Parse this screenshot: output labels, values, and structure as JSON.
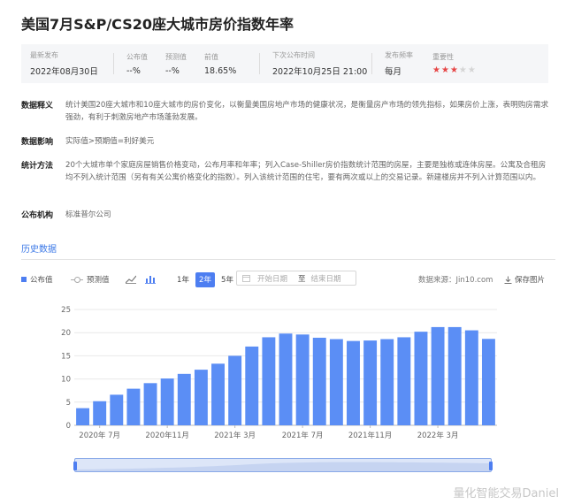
{
  "title": "美国7月S&P/CS20座大城市房价指数年率",
  "info": {
    "latest_label": "最新发布",
    "latest_value": "2022年08月30日",
    "actual_label": "公布值",
    "actual_value": "--%",
    "forecast_label": "预测值",
    "forecast_value": "--%",
    "previous_label": "前值",
    "previous_value": "18.65%",
    "next_label": "下次公布时间",
    "next_value": "2022年10月25日 21:00",
    "freq_label": "发布频率",
    "freq_value": "每月",
    "importance_label": "重要性",
    "importance_stars": 3,
    "importance_max": 5
  },
  "details": [
    {
      "label": "数据释义",
      "text": "统计美国20座大城市和10座大城市的房价变化，以衡量美国房地产市场的健康状况，是衡量房产市场的领先指标，如果房价上涨，表明购房需求强劲，有利于刺激房地产市场蓬勃发展。"
    },
    {
      "label": "数据影响",
      "text": "实际值>预期值=利好美元"
    },
    {
      "label": "统计方法",
      "text": "20个大城市单个家庭房屋销售价格变动，公布月率和年率；列入Case-Shiller房价指数统计范围的房屋，主要是独栋或连体房屋。公寓及合租房均不列入统计范围（另有有关公寓价格变化的指数）。列入该统计范围的住宅，要有两次或以上的交易记录。新建楼房并不列入计算范围以内。"
    },
    {
      "label": "公布机构",
      "text": "标准普尔公司"
    }
  ],
  "history_label": "历史数据",
  "controls": {
    "legend_actual": "公布值",
    "legend_forecast": "预测值",
    "periods": [
      "1年",
      "2年",
      "5年"
    ],
    "active_period": "2年",
    "start_placeholder": "开始日期",
    "to_label": "至",
    "end_placeholder": "结束日期",
    "source": "数据来源：Jin10.com",
    "save_label": "保存图片"
  },
  "colors": {
    "bar": "#5b8ef5",
    "accent": "#4d7ef1",
    "star_on": "#e64545"
  },
  "icons": [
    "line-chart-icon",
    "bar-chart-icon",
    "calendar-icon",
    "download-icon"
  ],
  "chart_data": {
    "type": "bar",
    "categories": [
      "2020年6月",
      "2020年7月",
      "2020年8月",
      "2020年9月",
      "2020年10月",
      "2020年11月",
      "2020年12月",
      "2021年1月",
      "2021年2月",
      "2021年3月",
      "2021年4月",
      "2021年5月",
      "2021年6月",
      "2021年7月",
      "2021年8月",
      "2021年9月",
      "2021年10月",
      "2021年11月",
      "2021年12月",
      "2022年1月",
      "2022年2月",
      "2022年3月",
      "2022年4月",
      "2022年5月",
      "2022年6月"
    ],
    "x_tick_labels": [
      {
        "index": 1,
        "label": "2020年 7月"
      },
      {
        "index": 5,
        "label": "2020年11月"
      },
      {
        "index": 9,
        "label": "2021年 3月"
      },
      {
        "index": 13,
        "label": "2021年 7月"
      },
      {
        "index": 17,
        "label": "2021年11月"
      },
      {
        "index": 21,
        "label": "2022年 3月"
      }
    ],
    "values": [
      3.7,
      5.2,
      6.6,
      7.9,
      9.1,
      10.1,
      11.1,
      12.0,
      13.3,
      15.0,
      17.0,
      19.0,
      19.8,
      19.6,
      18.9,
      18.6,
      18.2,
      18.3,
      18.6,
      19.0,
      20.2,
      21.2,
      21.2,
      20.5,
      18.65
    ],
    "ylim": [
      0,
      25
    ],
    "yticks": [
      0,
      5,
      10,
      15,
      20,
      25
    ],
    "grid": true
  },
  "watermark": "量化智能交易Daniel"
}
